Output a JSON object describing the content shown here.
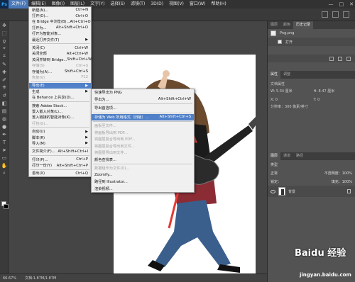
{
  "menubar": {
    "logo": "Ps",
    "items": [
      {
        "label": "文件(F)"
      },
      {
        "label": "编辑(E)"
      },
      {
        "label": "图像(I)"
      },
      {
        "label": "图层(L)"
      },
      {
        "label": "文字(Y)"
      },
      {
        "label": "选择(S)"
      },
      {
        "label": "滤镜(T)"
      },
      {
        "label": "3D(D)"
      },
      {
        "label": "视图(V)"
      },
      {
        "label": "窗口(W)"
      },
      {
        "label": "帮助(H)"
      }
    ],
    "window_controls": [
      "—",
      "□",
      "✕"
    ]
  },
  "file_menu": {
    "items": [
      {
        "label": "新建(N)...",
        "shortcut": "Ctrl+N",
        "disabled": false
      },
      {
        "label": "打开(O)...",
        "shortcut": "Ctrl+O",
        "disabled": false
      },
      {
        "label": "在 Bridge 中浏览(B)...",
        "shortcut": "Alt+Ctrl+O",
        "disabled": false
      },
      {
        "label": "打开为...",
        "shortcut": "Alt+Shift+Ctrl+O",
        "disabled": false
      },
      {
        "label": "打开为智能对象...",
        "shortcut": "",
        "disabled": false
      },
      {
        "label": "最近打开文件(T)",
        "shortcut": "",
        "disabled": false,
        "submenu": true
      },
      {
        "sep": true
      },
      {
        "label": "关闭(C)",
        "shortcut": "Ctrl+W",
        "disabled": false
      },
      {
        "label": "关闭全部",
        "shortcut": "Alt+Ctrl+W",
        "disabled": false
      },
      {
        "label": "关闭并转到 Bridge...",
        "shortcut": "Shift+Ctrl+W",
        "disabled": false
      },
      {
        "label": "存储(S)",
        "shortcut": "Ctrl+S",
        "disabled": true
      },
      {
        "label": "存储为(A)...",
        "shortcut": "Shift+Ctrl+S",
        "disabled": false
      },
      {
        "label": "恢复(V)",
        "shortcut": "F12",
        "disabled": true
      },
      {
        "sep": true
      },
      {
        "label": "导出(E)",
        "shortcut": "",
        "disabled": false,
        "submenu": true,
        "highlighted": true
      },
      {
        "label": "生成",
        "shortcut": "",
        "disabled": false,
        "submenu": true
      },
      {
        "label": "在 Behance 上共享(D)...",
        "shortcut": "",
        "disabled": false
      },
      {
        "sep": true
      },
      {
        "label": "搜索 Adobe Stock...",
        "shortcut": "",
        "disabled": false
      },
      {
        "label": "置入嵌入对象(L)...",
        "shortcut": "",
        "disabled": false
      },
      {
        "label": "置入链接的智能对象(K)...",
        "shortcut": "",
        "disabled": false
      },
      {
        "label": "打包(G)...",
        "shortcut": "",
        "disabled": true
      },
      {
        "sep": true
      },
      {
        "label": "自动(U)",
        "shortcut": "",
        "disabled": false,
        "submenu": true
      },
      {
        "label": "脚本(R)",
        "shortcut": "",
        "disabled": false,
        "submenu": true
      },
      {
        "label": "导入(M)",
        "shortcut": "",
        "disabled": false,
        "submenu": true
      },
      {
        "sep": true
      },
      {
        "label": "文件简介(F)...",
        "shortcut": "Alt+Shift+Ctrl+I",
        "disabled": false
      },
      {
        "sep": true
      },
      {
        "label": "打印(P)...",
        "shortcut": "Ctrl+P",
        "disabled": false
      },
      {
        "label": "打印一份(Y)",
        "shortcut": "Alt+Shift+Ctrl+P",
        "disabled": false
      },
      {
        "sep": true
      },
      {
        "label": "退出(X)",
        "shortcut": "Ctrl+Q",
        "disabled": false
      }
    ]
  },
  "export_submenu": {
    "items": [
      {
        "label": "快速导出为 PNG",
        "shortcut": "",
        "disabled": false
      },
      {
        "label": "导出为...",
        "shortcut": "Alt+Shift+Ctrl+W",
        "disabled": false
      },
      {
        "sep": true
      },
      {
        "label": "导出首选项...",
        "shortcut": "",
        "disabled": false
      },
      {
        "sep": true
      },
      {
        "label": "存储为 Web 所用格式（旧版）...",
        "shortcut": "Alt+Shift+Ctrl+S",
        "disabled": false,
        "highlighted": true
      },
      {
        "sep": true
      },
      {
        "label": "画板至文件...",
        "shortcut": "",
        "disabled": true
      },
      {
        "label": "将画板导出到 PDF...",
        "shortcut": "",
        "disabled": true
      },
      {
        "label": "将图层复合导出到 PDF...",
        "shortcut": "",
        "disabled": true
      },
      {
        "label": "将图层复合导出到文件...",
        "shortcut": "",
        "disabled": true
      },
      {
        "label": "将图层导出到文件...",
        "shortcut": "",
        "disabled": true
      },
      {
        "label": "颜色查找表...",
        "shortcut": "",
        "disabled": false
      },
      {
        "sep": true
      },
      {
        "label": "数据组作为文件(D)...",
        "shortcut": "",
        "disabled": true
      },
      {
        "label": "Zoomify...",
        "shortcut": "",
        "disabled": false
      },
      {
        "label": "路径到 Illustrator...",
        "shortcut": "",
        "disabled": false
      },
      {
        "label": "渲染视频...",
        "shortcut": "",
        "disabled": false
      }
    ]
  },
  "history_panel": {
    "tabs": [
      "图层",
      "颜色",
      "历史记录"
    ],
    "snapshot_name": "Png.png",
    "entries": [
      "打开"
    ]
  },
  "properties_panel": {
    "tabs": [
      "属性",
      "调整"
    ],
    "section_title": "文档属性",
    "w_label": "W:",
    "w_value": "5.34 厘米",
    "h_label": "H:",
    "h_value": "8.47 厘米",
    "x_label": "X:",
    "x_value": "0",
    "y_label": "Y:",
    "y_value": "0",
    "resolution": "分辨率：300 像素/英寸"
  },
  "layers_panel": {
    "tabs": [
      "图层",
      "通道",
      "路径"
    ],
    "kind_label": "类型",
    "blend_mode": "正常",
    "opacity_label": "不透明度：100%",
    "lock_label": "锁定：",
    "fill_label": "填充：100%",
    "layers": [
      {
        "name": "背景"
      }
    ]
  },
  "status_bar": {
    "zoom": "66.67%",
    "doc_info": "文档:1.87M/1.87M"
  },
  "watermark": {
    "site_logo": "Baidu 经验",
    "site_url": "jingyan.baidu.com"
  },
  "colors": {
    "highlight": "#5080c8",
    "arrow": "#e53935"
  },
  "tools": [
    "move-icon",
    "marquee-icon",
    "lasso-icon",
    "quick-select-icon",
    "crop-icon",
    "eyedropper-icon",
    "heal-icon",
    "brush-icon",
    "stamp-icon",
    "history-brush-icon",
    "eraser-icon",
    "gradient-icon",
    "blur-icon",
    "dodge-icon",
    "pen-icon",
    "type-icon",
    "path-select-icon",
    "shape-icon",
    "hand-icon",
    "zoom-icon"
  ]
}
